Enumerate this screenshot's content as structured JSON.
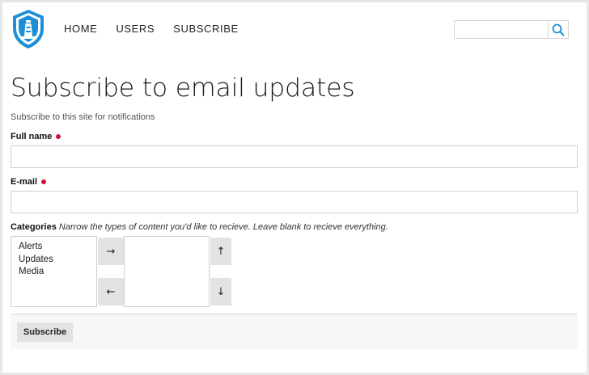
{
  "nav": {
    "items": [
      {
        "label": "HOME"
      },
      {
        "label": "USERS"
      },
      {
        "label": "SUBSCRIBE"
      }
    ]
  },
  "search": {
    "value": "",
    "placeholder": ""
  },
  "page": {
    "title": "Subscribe to email updates",
    "description": "Subscribe to this site for notifications"
  },
  "form": {
    "full_name": {
      "label": "Full name",
      "value": ""
    },
    "email": {
      "label": "E-mail",
      "value": ""
    },
    "categories": {
      "label": "Categories",
      "help": "Narrow the types of content you'd like to recieve. Leave blank to recieve everything.",
      "available": [
        "Alerts",
        "Updates",
        "Media"
      ],
      "selected": []
    },
    "move_right_glyph": "→",
    "move_left_glyph": "←",
    "move_up_glyph": "↑",
    "move_down_glyph": "↓",
    "submit_label": "Subscribe"
  },
  "colors": {
    "brand_blue": "#1e8fd6",
    "required": "#d0103a",
    "search_icon": "#1e8fd6"
  },
  "icons": {
    "logo": "lighthouse-shield-logo",
    "search": "search-icon"
  }
}
